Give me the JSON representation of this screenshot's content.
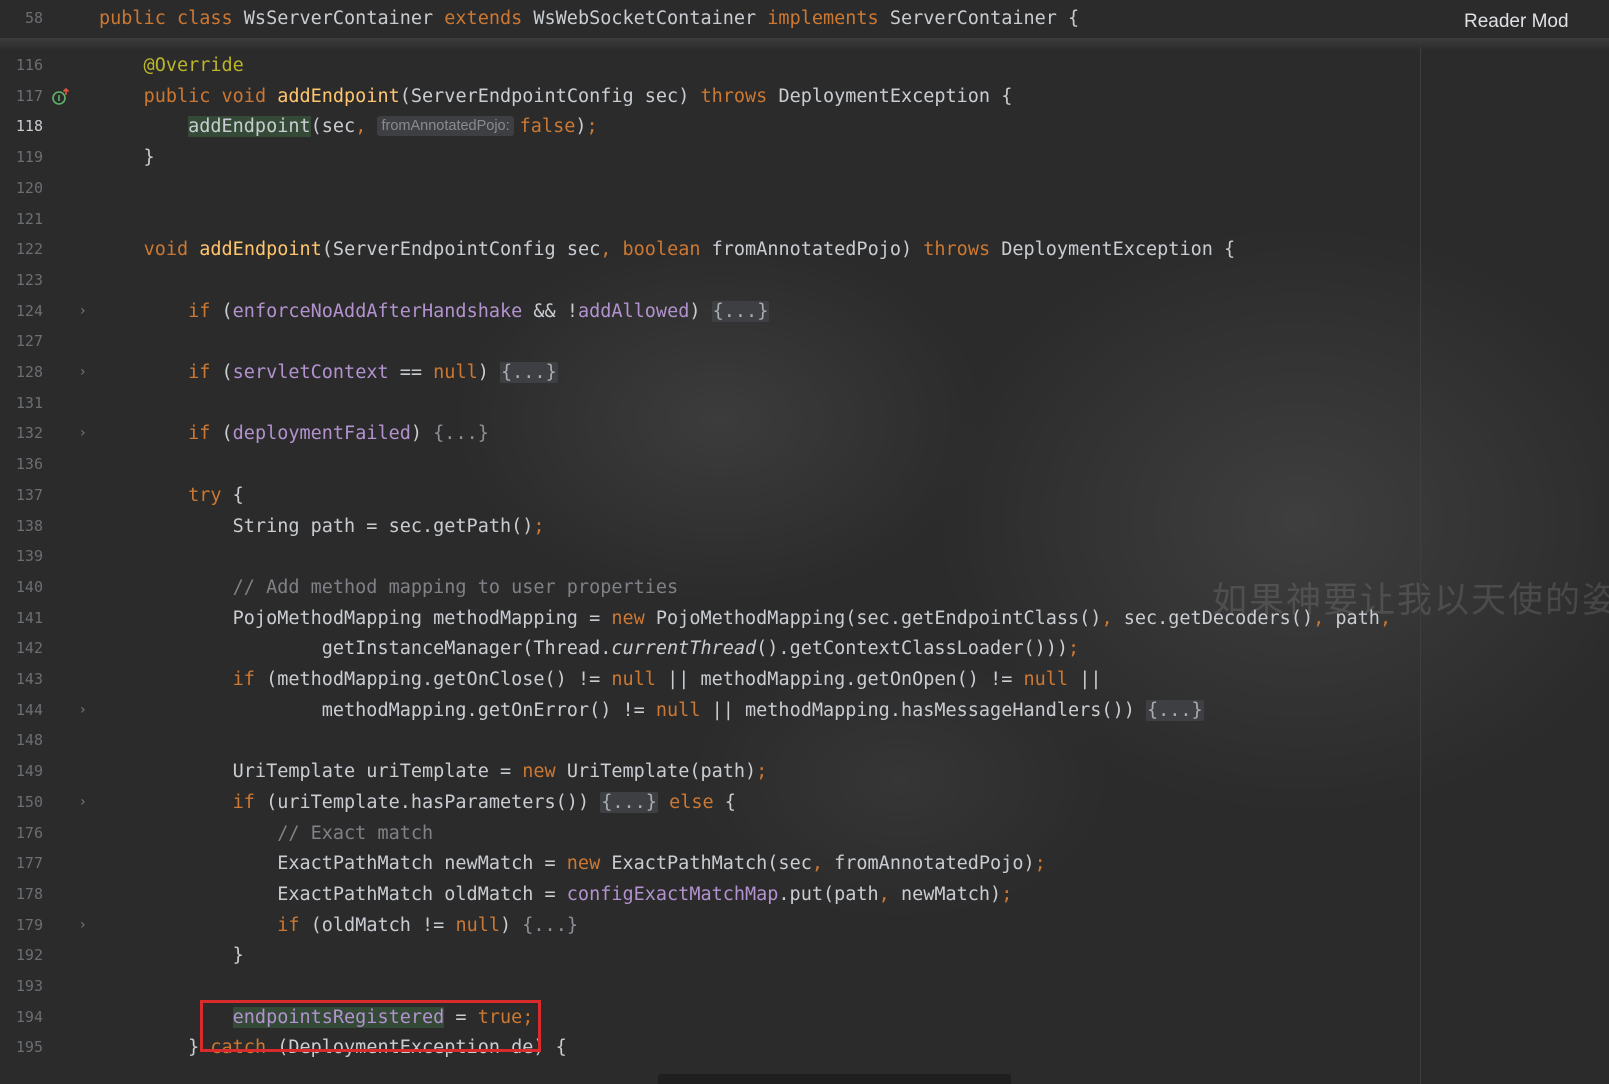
{
  "sticky_header": {
    "line_number": "58",
    "tokens": [
      {
        "t": "public class ",
        "c": "kw"
      },
      {
        "t": "WsServerContainer ",
        "c": ""
      },
      {
        "t": "extends ",
        "c": "kw"
      },
      {
        "t": "WsWebSocketContainer ",
        "c": ""
      },
      {
        "t": "implements ",
        "c": "kw"
      },
      {
        "t": "ServerContainer {",
        "c": ""
      }
    ]
  },
  "reader_mode": {
    "label": "Reader Mod"
  },
  "watermark": {
    "text": "如果神要让我以天使的姿态"
  },
  "lines": [
    {
      "ln": "116",
      "tokens": [
        {
          "t": "    @Override",
          "c": "ann"
        }
      ]
    },
    {
      "ln": "117",
      "icon": "override-up-arrow",
      "tokens": [
        {
          "t": "    ",
          "c": ""
        },
        {
          "t": "public void ",
          "c": "kw"
        },
        {
          "t": "addEndpoint",
          "c": "fn"
        },
        {
          "t": "(ServerEndpointConfig sec) ",
          "c": ""
        },
        {
          "t": "throws ",
          "c": "kw"
        },
        {
          "t": "DeploymentException {",
          "c": ""
        }
      ]
    },
    {
      "ln": "118",
      "current": true,
      "tokens": [
        {
          "t": "        ",
          "c": ""
        },
        {
          "t": "addEndpoint",
          "c": "hl-green"
        },
        {
          "t": "(sec",
          "c": ""
        },
        {
          "t": ", ",
          "c": "kw"
        },
        {
          "t": "fromAnnotatedPojo:",
          "c": "hint"
        },
        {
          "t": "false",
          "c": "kw"
        },
        {
          "t": ")",
          "c": ""
        },
        {
          "t": ";",
          "c": "kw"
        }
      ]
    },
    {
      "ln": "119",
      "tokens": [
        {
          "t": "    }",
          "c": ""
        }
      ]
    },
    {
      "ln": "120",
      "tokens": []
    },
    {
      "ln": "121",
      "tokens": []
    },
    {
      "ln": "122",
      "tokens": [
        {
          "t": "    ",
          "c": ""
        },
        {
          "t": "void ",
          "c": "kw"
        },
        {
          "t": "addEndpoint",
          "c": "fn"
        },
        {
          "t": "(ServerEndpointConfig sec",
          "c": ""
        },
        {
          "t": ", ",
          "c": "kw"
        },
        {
          "t": "boolean ",
          "c": "kw"
        },
        {
          "t": "fromAnnotatedPojo) ",
          "c": ""
        },
        {
          "t": "throws ",
          "c": "kw"
        },
        {
          "t": "DeploymentException {",
          "c": ""
        }
      ]
    },
    {
      "ln": "123",
      "tokens": []
    },
    {
      "ln": "124",
      "fold": true,
      "tokens": [
        {
          "t": "        ",
          "c": ""
        },
        {
          "t": "if ",
          "c": "kw"
        },
        {
          "t": "(",
          "c": ""
        },
        {
          "t": "enforceNoAddAfterHandshake",
          "c": "fd"
        },
        {
          "t": " && !",
          "c": ""
        },
        {
          "t": "addAllowed",
          "c": "fd"
        },
        {
          "t": ") ",
          "c": ""
        },
        {
          "t": "{...}",
          "c": "fold"
        }
      ]
    },
    {
      "ln": "127",
      "tokens": []
    },
    {
      "ln": "128",
      "fold": true,
      "tokens": [
        {
          "t": "        ",
          "c": ""
        },
        {
          "t": "if ",
          "c": "kw"
        },
        {
          "t": "(",
          "c": ""
        },
        {
          "t": "servletContext",
          "c": "fd"
        },
        {
          "t": " == ",
          "c": ""
        },
        {
          "t": "null",
          "c": "kw"
        },
        {
          "t": ") ",
          "c": ""
        },
        {
          "t": "{...}",
          "c": "fold"
        }
      ]
    },
    {
      "ln": "131",
      "tokens": []
    },
    {
      "ln": "132",
      "fold": true,
      "tokens": [
        {
          "t": "        ",
          "c": ""
        },
        {
          "t": "if ",
          "c": "kw"
        },
        {
          "t": "(",
          "c": ""
        },
        {
          "t": "deploymentFailed",
          "c": "fd"
        },
        {
          "t": ") ",
          "c": ""
        },
        {
          "t": "{...}",
          "c": "gray"
        }
      ]
    },
    {
      "ln": "136",
      "tokens": []
    },
    {
      "ln": "137",
      "tokens": [
        {
          "t": "        ",
          "c": ""
        },
        {
          "t": "try ",
          "c": "kw"
        },
        {
          "t": "{",
          "c": ""
        }
      ]
    },
    {
      "ln": "138",
      "tokens": [
        {
          "t": "            String path = sec.getPath()",
          "c": ""
        },
        {
          "t": ";",
          "c": "kw"
        }
      ]
    },
    {
      "ln": "139",
      "tokens": []
    },
    {
      "ln": "140",
      "tokens": [
        {
          "t": "            // Add method mapping to user properties",
          "c": "cm"
        }
      ]
    },
    {
      "ln": "141",
      "tokens": [
        {
          "t": "            PojoMethodMapping methodMapping = ",
          "c": ""
        },
        {
          "t": "new ",
          "c": "kw"
        },
        {
          "t": "PojoMethodMapping(sec.getEndpointClass()",
          "c": ""
        },
        {
          "t": ", ",
          "c": "kw"
        },
        {
          "t": "sec.getDecoders()",
          "c": ""
        },
        {
          "t": ", ",
          "c": "kw"
        },
        {
          "t": "path",
          "c": ""
        },
        {
          "t": ",",
          "c": "kw"
        }
      ]
    },
    {
      "ln": "142",
      "tokens": [
        {
          "t": "                    getInstanceManager(Thread.",
          "c": ""
        },
        {
          "t": "currentThread",
          "c": "it"
        },
        {
          "t": "().getContextClassLoader()))",
          "c": ""
        },
        {
          "t": ";",
          "c": "kw"
        }
      ]
    },
    {
      "ln": "143",
      "tokens": [
        {
          "t": "            ",
          "c": ""
        },
        {
          "t": "if ",
          "c": "kw"
        },
        {
          "t": "(methodMapping.getOnClose() != ",
          "c": ""
        },
        {
          "t": "null ",
          "c": "kw"
        },
        {
          "t": "|| methodMapping.getOnOpen() != ",
          "c": ""
        },
        {
          "t": "null ",
          "c": "kw"
        },
        {
          "t": "||",
          "c": ""
        }
      ]
    },
    {
      "ln": "144",
      "fold": true,
      "tokens": [
        {
          "t": "                    methodMapping.getOnError() != ",
          "c": ""
        },
        {
          "t": "null ",
          "c": "kw"
        },
        {
          "t": "|| methodMapping.hasMessageHandlers()) ",
          "c": ""
        },
        {
          "t": "{...}",
          "c": "fold"
        }
      ]
    },
    {
      "ln": "148",
      "tokens": []
    },
    {
      "ln": "149",
      "tokens": [
        {
          "t": "            UriTemplate uriTemplate = ",
          "c": ""
        },
        {
          "t": "new ",
          "c": "kw"
        },
        {
          "t": "UriTemplate(path)",
          "c": ""
        },
        {
          "t": ";",
          "c": "kw"
        }
      ]
    },
    {
      "ln": "150",
      "fold": true,
      "tokens": [
        {
          "t": "            ",
          "c": ""
        },
        {
          "t": "if ",
          "c": "kw"
        },
        {
          "t": "(uriTemplate.hasParameters()) ",
          "c": ""
        },
        {
          "t": "{...}",
          "c": "fold"
        },
        {
          "t": " ",
          "c": ""
        },
        {
          "t": "else ",
          "c": "kw"
        },
        {
          "t": "{",
          "c": ""
        }
      ]
    },
    {
      "ln": "176",
      "tokens": [
        {
          "t": "                // Exact match",
          "c": "cm"
        }
      ]
    },
    {
      "ln": "177",
      "tokens": [
        {
          "t": "                ExactPathMatch newMatch = ",
          "c": ""
        },
        {
          "t": "new ",
          "c": "kw"
        },
        {
          "t": "ExactPathMatch(sec",
          "c": ""
        },
        {
          "t": ", ",
          "c": "kw"
        },
        {
          "t": "fromAnnotatedPojo)",
          "c": ""
        },
        {
          "t": ";",
          "c": "kw"
        }
      ]
    },
    {
      "ln": "178",
      "tokens": [
        {
          "t": "                ExactPathMatch oldMatch = ",
          "c": ""
        },
        {
          "t": "configExactMatchMap",
          "c": "fd"
        },
        {
          "t": ".put(path",
          "c": ""
        },
        {
          "t": ", ",
          "c": "kw"
        },
        {
          "t": "newMatch)",
          "c": ""
        },
        {
          "t": ";",
          "c": "kw"
        }
      ]
    },
    {
      "ln": "179",
      "fold": true,
      "tokens": [
        {
          "t": "                ",
          "c": ""
        },
        {
          "t": "if ",
          "c": "kw"
        },
        {
          "t": "(oldMatch != ",
          "c": ""
        },
        {
          "t": "null",
          "c": "kw"
        },
        {
          "t": ") ",
          "c": ""
        },
        {
          "t": "{...}",
          "c": "gray"
        }
      ]
    },
    {
      "ln": "192",
      "tokens": [
        {
          "t": "            }",
          "c": ""
        }
      ]
    },
    {
      "ln": "193",
      "tokens": []
    },
    {
      "ln": "194",
      "tokens": [
        {
          "t": "            ",
          "c": ""
        },
        {
          "t": "endpointsRegistered",
          "c": "fd hl-green"
        },
        {
          "t": " = ",
          "c": ""
        },
        {
          "t": "true",
          "c": "kw"
        },
        {
          "t": ";",
          "c": "kw"
        }
      ]
    },
    {
      "ln": "195",
      "tokens": [
        {
          "t": "        } ",
          "c": ""
        },
        {
          "t": "catch ",
          "c": "kw"
        },
        {
          "t": "(DeploymentException de) {",
          "c": ""
        }
      ]
    }
  ]
}
